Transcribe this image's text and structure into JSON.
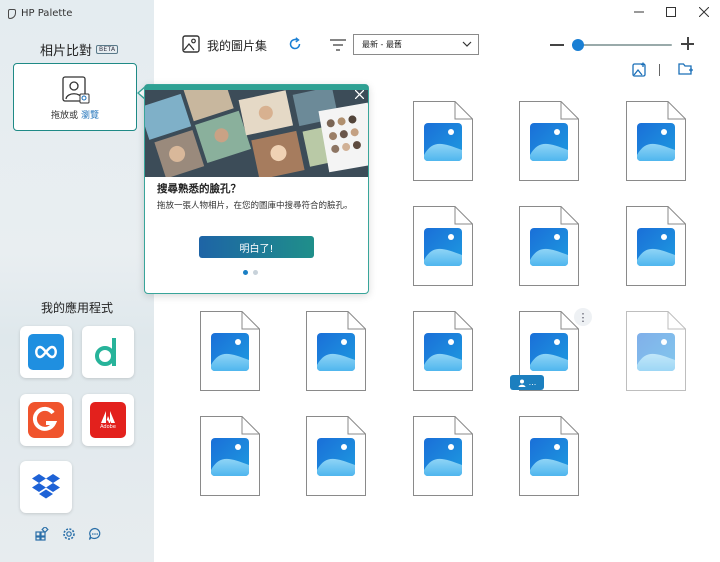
{
  "window": {
    "app_title": "HP Palette",
    "minimize_icon": "minimize-icon",
    "maximize_icon": "maximize-icon",
    "close_icon": "close-icon"
  },
  "sidebar": {
    "face_compare": {
      "title": "相片比對",
      "badge": "BETA",
      "drop_text": "拖放或",
      "browse_link": "瀏覽",
      "icon": "person-search-icon"
    },
    "apps_title": "我的應用程式",
    "apps": [
      {
        "id": "infinity",
        "icon": "infinity-icon",
        "color": "#1f8fe0"
      },
      {
        "id": "d-app",
        "icon": "d-letter-icon",
        "color": "#27b39a"
      },
      {
        "id": "g-app",
        "icon": "g-letter-icon",
        "color": "#f0542d"
      },
      {
        "id": "adobe",
        "icon": "adobe-icon",
        "label": "Adobe",
        "color": "#e3211d"
      },
      {
        "id": "dropbox",
        "icon": "dropbox-icon",
        "color": "#1e62d6"
      }
    ],
    "bottom_icons": [
      "add-widget-icon",
      "settings-icon",
      "feedback-icon"
    ]
  },
  "toolbar": {
    "gallery_title": "我的圖片集",
    "sort_value": "最新 - 最舊",
    "zoom_level": 0.06,
    "accent": "#1a7fd4"
  },
  "popover": {
    "title": "搜尋熟悉的臉孔？",
    "body": "拖放一張人物相片，在您的圖庫中搜尋符合的臉孔。",
    "button": "明白了!",
    "page_count": 2,
    "active_page": 1,
    "close_icon": "close-icon"
  },
  "gallery": {
    "item_count": 19,
    "item_icon": "image-file-icon",
    "selected_item_index": 10,
    "selected_badge_text": "..."
  }
}
